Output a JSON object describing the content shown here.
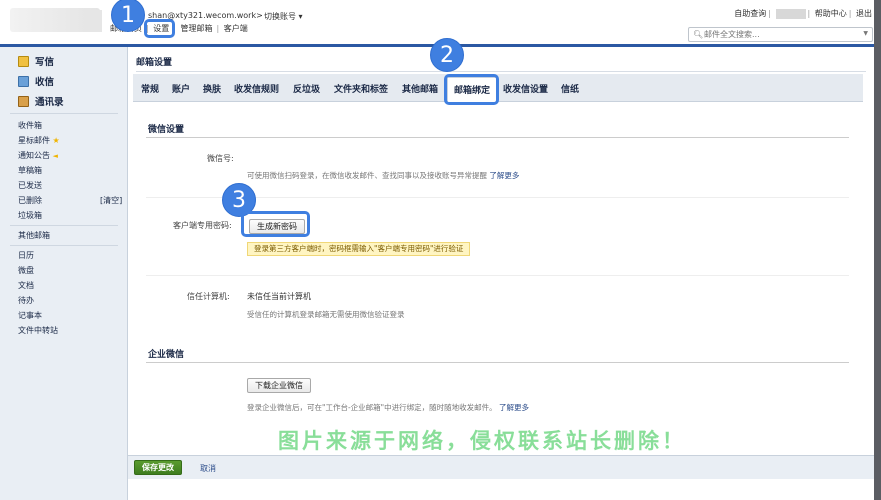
{
  "header": {
    "account": "shan@xty321.wecom.work>",
    "switch_label": "切换账号 ▾",
    "links": [
      "邮箱首页",
      "设置",
      "管理邮箱",
      "客户端"
    ],
    "right_links": [
      "自助查询",
      "帮助中心",
      "退出"
    ],
    "search_placeholder": "邮件全文搜索..."
  },
  "sidebar": {
    "main": [
      "写信",
      "收信",
      "通讯录"
    ],
    "folders": [
      "收件箱",
      "星标邮件",
      "通知公告",
      "草稿箱",
      "已发送",
      "已删除",
      "垃圾箱"
    ],
    "clear_label": "[清空]",
    "other": "其他邮箱",
    "tools": [
      "日历",
      "微盘",
      "文档",
      "待办",
      "记事本",
      "文件中转站"
    ]
  },
  "content": {
    "title": "邮箱设置",
    "tabs": [
      "常规",
      "账户",
      "换肤",
      "收发信规则",
      "反垃圾",
      "文件夹和标签",
      "其他邮箱",
      "邮箱绑定",
      "收发信设置",
      "信纸"
    ],
    "wechat": {
      "section_title": "微信设置",
      "wechat_label": "微信号:",
      "wechat_hint": "可使用微信扫码登录，在微信收发邮件、查找同事以及接收账号异常提醒",
      "learn_more": "了解更多",
      "client_pwd_label": "客户端专用密码:",
      "generate_button": "生成新密码",
      "client_pwd_warning": "登录第三方客户端时，密码框需输入\"客户端专用密码\"进行验证",
      "trusted_label": "信任计算机:",
      "trusted_value": "未信任当前计算机",
      "trusted_hint": "受信任的计算机登录邮箱无需使用微信验证登录"
    },
    "wework": {
      "section_title": "企业微信",
      "download_button": "下载企业微信",
      "hint": "登录企业微信后，可在\"工作台-企业邮箱\"中进行绑定，随时随地收发邮件。",
      "learn_more": "了解更多"
    },
    "footer": {
      "save": "保存更改",
      "cancel": "取消"
    }
  },
  "annotations": {
    "step1": "1",
    "step2": "2",
    "step3": "3"
  },
  "watermark": "图片来源于网络，侵权联系站长删除！",
  "colors": {
    "accent": "#3f7fe0",
    "nav": "#2b58a3",
    "save": "#4a8a24",
    "watermark": "#6cd680"
  }
}
